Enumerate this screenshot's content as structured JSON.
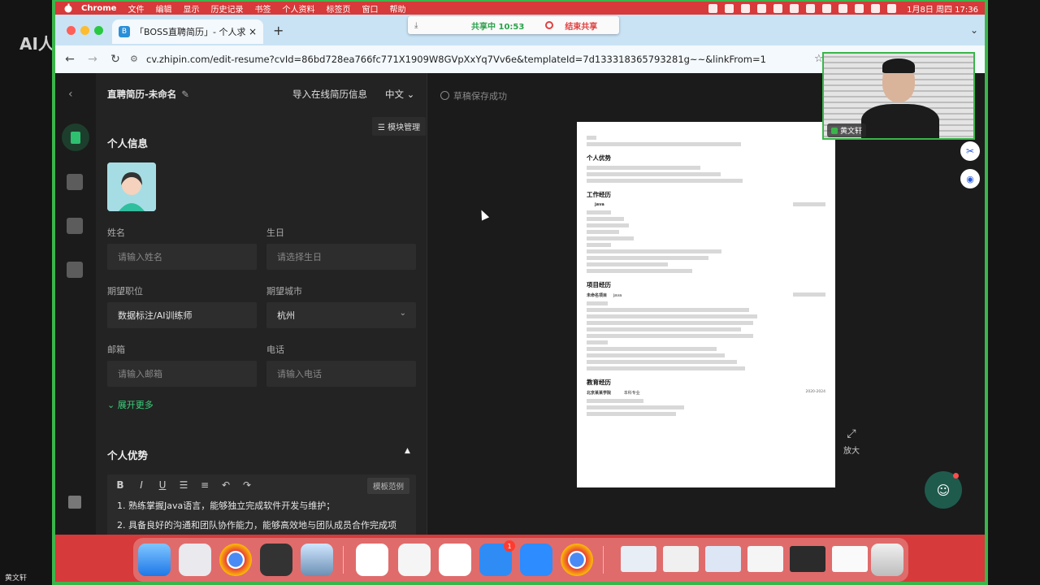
{
  "overlay": {
    "title": "AI人",
    "name": "黄文轩"
  },
  "menubar": {
    "app": "Chrome",
    "items": [
      "文件",
      "编辑",
      "显示",
      "历史记录",
      "书签",
      "个人资料",
      "标签页",
      "窗口",
      "帮助"
    ],
    "clock": "1月8日 周四 17:36"
  },
  "browser": {
    "tab_title": "「BOSS直聘简历」- 个人求职",
    "tab_favicon": "B",
    "new_tab": "+",
    "url": "cv.zhipin.com/edit-resume?cvId=86bd728ea766fc771X1909W8GVpXxYq7Vv6e&templateId=7d133318365793281g~~&linkFrom=1",
    "share": {
      "state": "共享中 10:53",
      "end": "结束共享"
    }
  },
  "editor": {
    "title": "直聘简历-未命名",
    "import_label": "导入在线简历信息",
    "lang": "中文",
    "module_label": "模块管理",
    "section_personal": "个人信息",
    "fields": {
      "name": {
        "label": "姓名",
        "placeholder": "请输入姓名"
      },
      "birthday": {
        "label": "生日",
        "placeholder": "请选择生日"
      },
      "position": {
        "label": "期望职位",
        "value": "数据标注/AI训练师"
      },
      "city": {
        "label": "期望城市",
        "value": "杭州"
      },
      "email": {
        "label": "邮箱",
        "placeholder": "请输入邮箱"
      },
      "phone": {
        "label": "电话",
        "placeholder": "请输入电话"
      }
    },
    "expand_more": "展开更多",
    "section_advantage": "个人优势",
    "template_example": "模板范例",
    "advantage_lines": [
      "1. 熟练掌握Java语言，能够独立完成软件开发与维护；",
      "2. 具备良好的沟通和团队协作能力，能够高效地与团队成员合作完成项"
    ]
  },
  "preview": {
    "saved": "草稿保存成功",
    "enlarge": "放大",
    "resume": {
      "sections": [
        "个人优势",
        "工作经历",
        "项目经历",
        "教育经历"
      ],
      "work_role": "java",
      "project_name": "未命名项目",
      "project_role": "java",
      "school": "北京某某学院",
      "degree": "本科专业",
      "edu_period": "2020-2024"
    }
  },
  "webcam": {
    "name": "黄文轩"
  }
}
